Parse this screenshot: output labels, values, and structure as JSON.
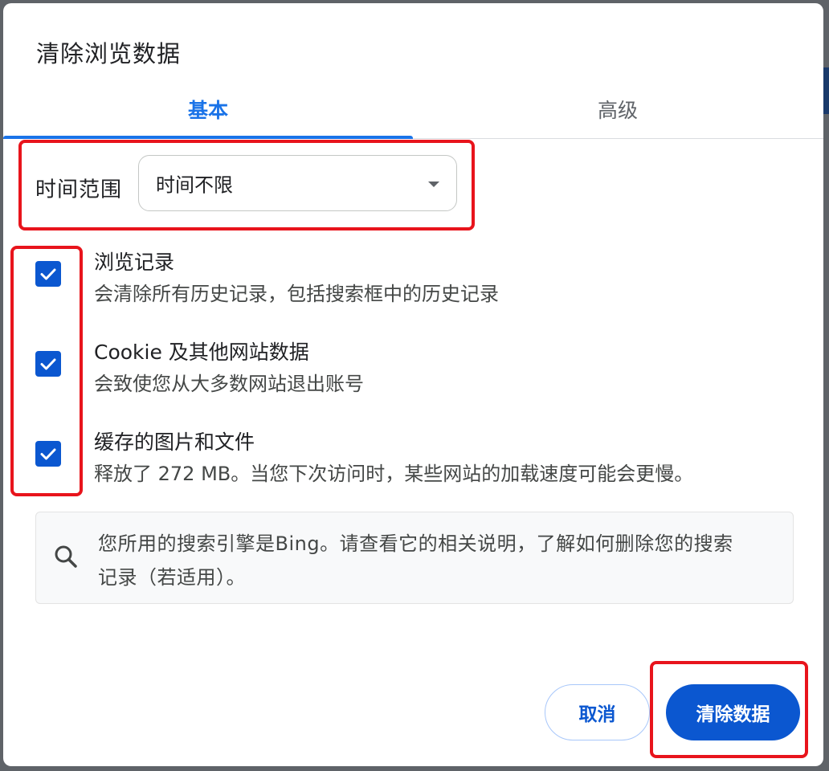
{
  "dialog": {
    "title": "清除浏览数据",
    "tabs": [
      {
        "label": "基本",
        "selected": true
      },
      {
        "label": "高级",
        "selected": false
      }
    ],
    "time_range": {
      "label": "时间范围",
      "selected_value": "时间不限"
    },
    "items": [
      {
        "title": "浏览记录",
        "description": "会清除所有历史记录，包括搜索框中的历史记录",
        "checked": true
      },
      {
        "title": "Cookie 及其他网站数据",
        "description": "会致使您从大多数网站退出账号",
        "checked": true
      },
      {
        "title": "缓存的图片和文件",
        "description": "释放了 272 MB。当您下次访问时，某些网站的加载速度可能会更慢。",
        "checked": true
      }
    ],
    "info": {
      "icon": "search-icon",
      "line1": "您所用的搜索引擎是Bing。请查看它的相关说明，了解如何删除您的搜索",
      "line2": "记录（若适用）。"
    },
    "buttons": {
      "cancel": "取消",
      "clear": "清除数据"
    }
  },
  "colors": {
    "accent": "#1a73e8",
    "primary_button": "#0b57d0",
    "annotation": "#e8141c"
  }
}
